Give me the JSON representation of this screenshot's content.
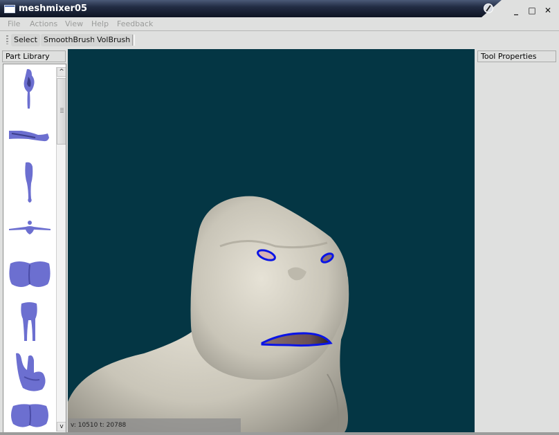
{
  "window": {
    "title": "meshmixer05",
    "controls": {
      "minimize": "_",
      "maximize": "□",
      "close": "✕"
    }
  },
  "menubar": {
    "items": [
      "File",
      "Actions",
      "View",
      "Help",
      "Feedback"
    ]
  },
  "toolbar": {
    "buttons": [
      "Select",
      "SmoothBrush",
      "VolBrush"
    ]
  },
  "part_library": {
    "title": "Part Library",
    "items": [
      {
        "name": "arm-vertical"
      },
      {
        "name": "arm-horizontal"
      },
      {
        "name": "leg"
      },
      {
        "name": "t-pose-body"
      },
      {
        "name": "buttocks"
      },
      {
        "name": "legs-pair"
      },
      {
        "name": "hand-gesture"
      },
      {
        "name": "chest"
      }
    ],
    "scroll_up": "^",
    "scroll_down": "v"
  },
  "viewport": {
    "background_color": "#043644",
    "model": "gorilla-head",
    "selection_color": "#0a14e6",
    "status": "v: 10510 t: 20788"
  },
  "tool_properties": {
    "title": "Tool Properties"
  }
}
